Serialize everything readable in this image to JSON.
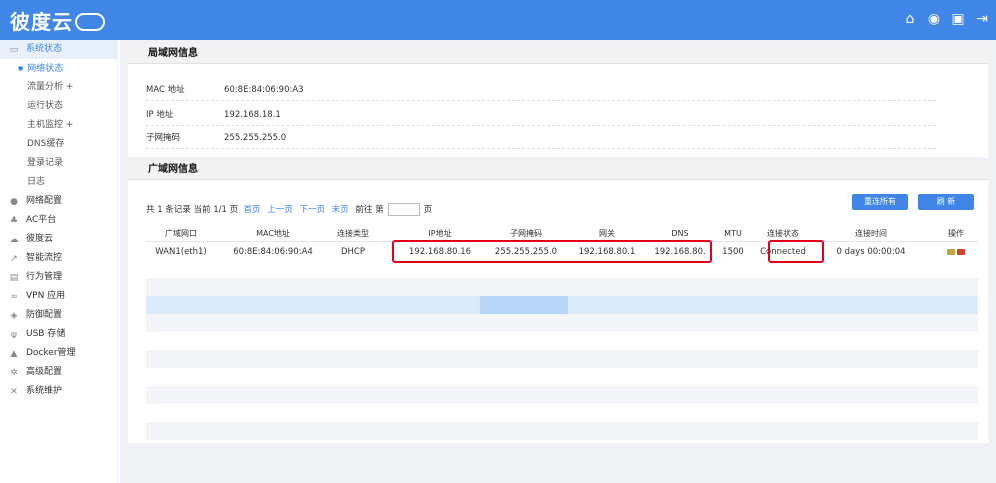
{
  "brand": {
    "logo_text": "彼度云"
  },
  "top_icons": [
    {
      "name": "home-icon",
      "glyph": "⌂"
    },
    {
      "name": "play-circle-icon",
      "glyph": "◉"
    },
    {
      "name": "screen-icon",
      "glyph": "▣"
    },
    {
      "name": "logout-icon",
      "glyph": "⇥"
    }
  ],
  "sidebar": {
    "items": [
      {
        "label": "系统状态",
        "icon": "monitor-icon",
        "glyph": "▭",
        "active": true
      },
      {
        "label": "网络配置",
        "icon": "globe-icon",
        "glyph": "●"
      },
      {
        "label": "AC平台",
        "icon": "network-icon",
        "glyph": "♣"
      },
      {
        "label": "彼度云",
        "icon": "cloud-icon",
        "glyph": "☁"
      },
      {
        "label": "智能流控",
        "icon": "chart-line-icon",
        "glyph": "↗"
      },
      {
        "label": "行为管理",
        "icon": "document-icon",
        "glyph": "▤"
      },
      {
        "label": "VPN 应用",
        "icon": "vpn-icon",
        "glyph": "∞"
      },
      {
        "label": "防御配置",
        "icon": "shield-icon",
        "glyph": "◈"
      },
      {
        "label": "USB 存储",
        "icon": "usb-icon",
        "glyph": "ψ"
      },
      {
        "label": "Docker管理",
        "icon": "docker-icon",
        "glyph": "▲"
      },
      {
        "label": "高级配置",
        "icon": "gear-icon",
        "glyph": "✲"
      },
      {
        "label": "系统维护",
        "icon": "tools-icon",
        "glyph": "✕"
      }
    ],
    "sub_items": [
      {
        "label": "网络状态",
        "current": true
      },
      {
        "label": "流量分析 +"
      },
      {
        "label": "运行状态"
      },
      {
        "label": "主机监控 +"
      },
      {
        "label": "DNS缓存"
      },
      {
        "label": "登录记录"
      },
      {
        "label": "日志"
      }
    ]
  },
  "lan": {
    "title": "局域网信息",
    "rows": [
      {
        "key": "MAC 地址",
        "value": "60:8E:84:06:90:A3"
      },
      {
        "key": "IP 地址",
        "value": "192.168.18.1"
      },
      {
        "key": "子网掩码",
        "value": "255.255.255.0"
      }
    ]
  },
  "wan": {
    "title": "广域网信息",
    "pager": {
      "summary": "共 1 条记录 当前 1/1 页",
      "first": "首页",
      "prev": "上一页",
      "next": "下一页",
      "last": "末页",
      "goto_label": "前往 第",
      "goto_suffix": "页"
    },
    "buttons": {
      "reconnect_all": "重连所有",
      "refresh": "刷 新"
    },
    "columns": [
      "广域网口",
      "MAC地址",
      "连接类型",
      "IP地址",
      "子网掩码",
      "网关",
      "DNS",
      "MTU",
      "连接状态",
      "连接时间",
      "操作"
    ],
    "rows": [
      {
        "port": "WAN1(eth1)",
        "mac": "60:8E:84:06:90:A4",
        "type": "DHCP",
        "ip": "192.168.80.16",
        "mask": "255.255.255.0",
        "gateway": "192.168.80.1",
        "dns": "192.168.80.",
        "mtu": "1500",
        "status": "Connected",
        "uptime": "0 days 00:00:04"
      }
    ]
  },
  "colors": {
    "brand_blue": "#3f86e6",
    "highlight_red": "#e4001b",
    "row_stripe": "#f3f5f8",
    "row_selected": "#dcebfb"
  }
}
